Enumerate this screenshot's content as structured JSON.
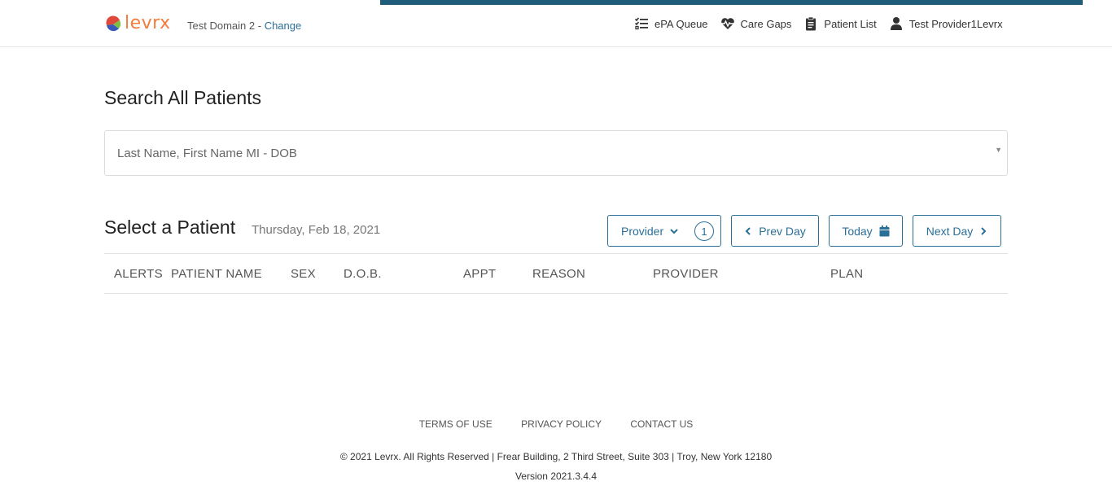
{
  "header": {
    "logo_text": "levrx",
    "domain_name": "Test Domain 2",
    "domain_separator": "-",
    "change_link": "Change",
    "nav": [
      {
        "label": "ePA Queue",
        "icon": "checklist-icon"
      },
      {
        "label": "Care Gaps",
        "icon": "heartbeat-icon"
      },
      {
        "label": "Patient List",
        "icon": "clipboard-icon"
      },
      {
        "label": "Test Provider1Levrx",
        "icon": "user-icon"
      }
    ]
  },
  "search": {
    "title": "Search All Patients",
    "placeholder": "Last Name, First Name MI - DOB"
  },
  "patients": {
    "title": "Select a Patient",
    "date": "Thursday, Feb 18, 2021",
    "provider_button": "Provider",
    "provider_count": "1",
    "prev_button": "Prev Day",
    "today_button": "Today",
    "next_button": "Next Day",
    "columns": [
      "ALERTS",
      "PATIENT NAME",
      "SEX",
      "D.O.B.",
      "APPT",
      "REASON",
      "PROVIDER",
      "PLAN"
    ]
  },
  "footer": {
    "links": [
      "TERMS OF USE",
      "PRIVACY POLICY",
      "CONTACT US"
    ],
    "copyright": "© 2021 Levrx. All Rights Reserved | Frear Building, 2 Third Street, Suite 303 | Troy, New York 12180",
    "version": "Version 2021.3.4.4"
  },
  "colors": {
    "accent": "#2a6f97",
    "top_bar": "#1f5c7a",
    "logo_orange": "#f47c3c"
  }
}
